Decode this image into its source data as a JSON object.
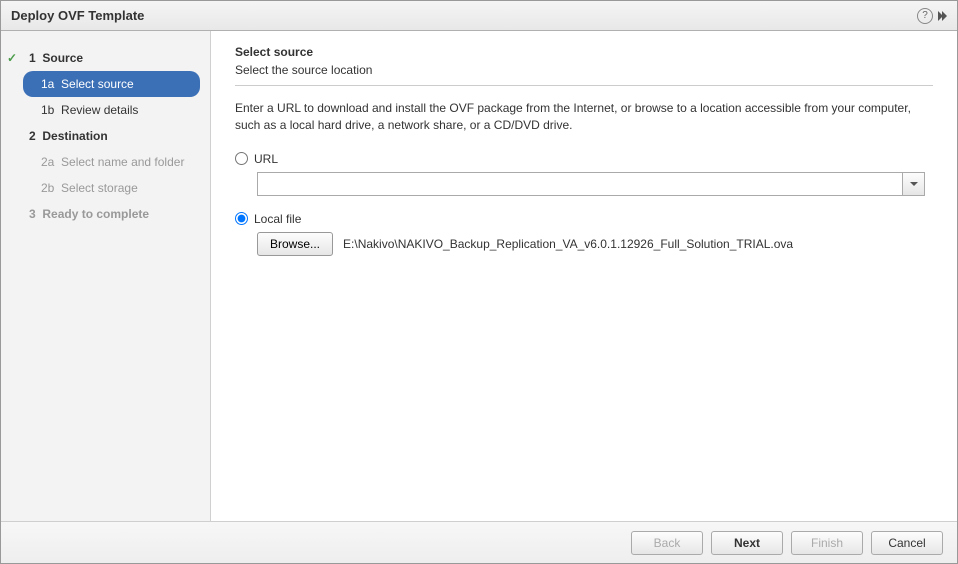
{
  "window": {
    "title": "Deploy OVF Template"
  },
  "sidebar": {
    "items": [
      {
        "num": "1",
        "label": "Source"
      },
      {
        "num": "1a",
        "label": "Select source"
      },
      {
        "num": "1b",
        "label": "Review details"
      },
      {
        "num": "2",
        "label": "Destination"
      },
      {
        "num": "2a",
        "label": "Select name and folder"
      },
      {
        "num": "2b",
        "label": "Select storage"
      },
      {
        "num": "3",
        "label": "Ready to complete"
      }
    ]
  },
  "content": {
    "title": "Select source",
    "subtitle": "Select the source location",
    "description": "Enter a URL to download and install the OVF package from the Internet, or browse to a location accessible from your computer, such as a local hard drive, a network share, or a CD/DVD drive.",
    "url_label": "URL",
    "url_value": "",
    "localfile_label": "Local file",
    "browse_label": "Browse...",
    "file_path": "E:\\Nakivo\\NAKIVO_Backup_Replication_VA_v6.0.1.12926_Full_Solution_TRIAL.ova"
  },
  "footer": {
    "back": "Back",
    "next": "Next",
    "finish": "Finish",
    "cancel": "Cancel"
  },
  "icons": {
    "help": "?",
    "check": "✓"
  }
}
